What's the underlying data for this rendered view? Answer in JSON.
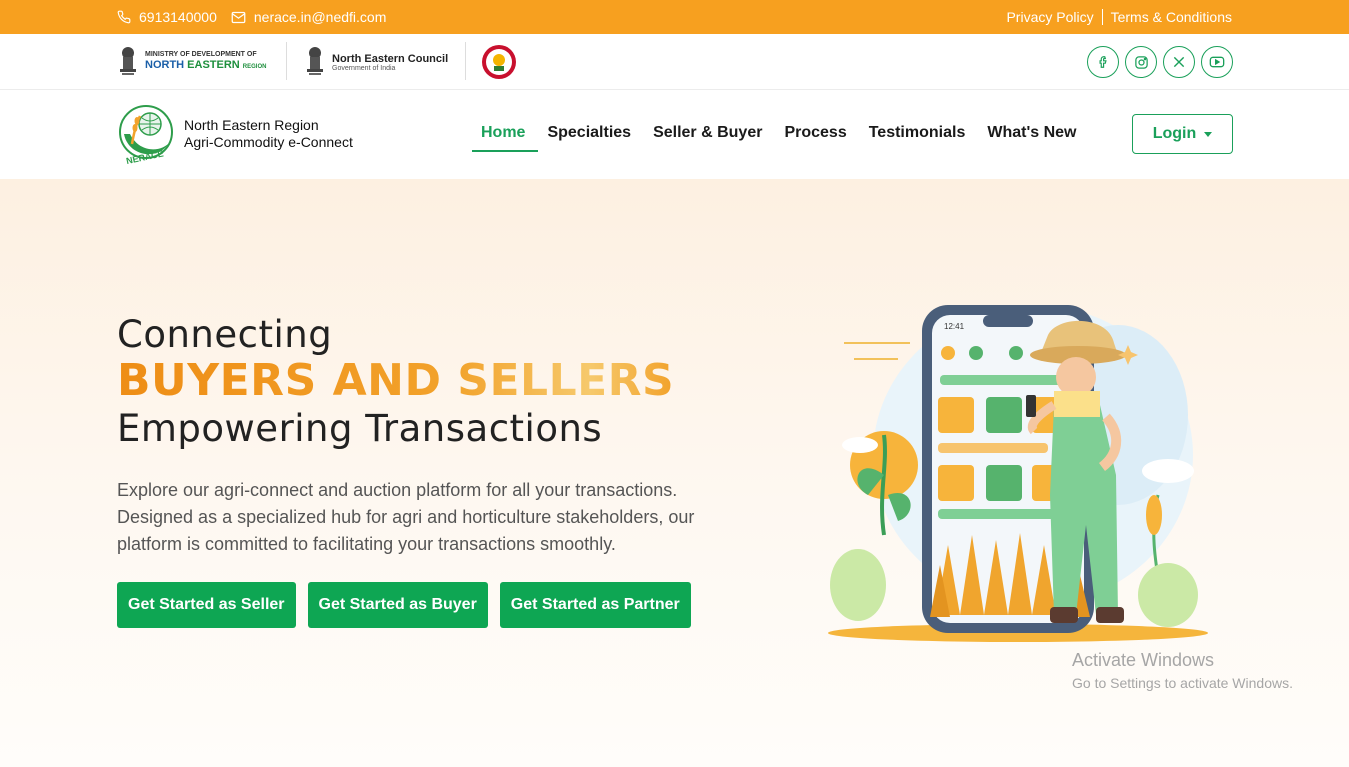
{
  "topbar": {
    "phone": "6913140000",
    "email": "nerace.in@nedfi.com",
    "privacy": "Privacy Policy",
    "terms": "Terms & Conditions"
  },
  "logos": {
    "mdoner_line1": "MINISTRY OF DEVELOPMENT OF",
    "mdoner_line2a": "NORTH ",
    "mdoner_line2b": "EASTERN",
    "mdoner_line3": "REGION",
    "nec_title": "North Eastern Council",
    "nec_sub": "Government of India"
  },
  "brand": {
    "line1": "North Eastern Region",
    "line2": "Agri-Commodity e-Connect",
    "badge": "NERACE"
  },
  "nav": {
    "items": [
      "Home",
      "Specialties",
      "Seller & Buyer",
      "Process",
      "Testimonials",
      "What's New"
    ],
    "login": "Login"
  },
  "hero": {
    "line1": "Connecting",
    "line2": "BUYERS AND SELLERS",
    "line3": "Empowering Transactions",
    "description": "Explore our agri-connect and auction platform for all your transactions. Designed as a specialized hub for agri and horticulture stakeholders, our platform is committed to facilitating your transactions smoothly.",
    "buttons": [
      "Get Started as Seller",
      "Get Started as Buyer",
      "Get Started as Partner"
    ],
    "phone_time": "12:41"
  },
  "watermark": {
    "title": "Activate Windows",
    "subtitle": "Go to Settings to activate Windows."
  },
  "colors": {
    "primary_green": "#0ea653",
    "accent_orange": "#f7a01f"
  },
  "icons": [
    "phone-icon",
    "mail-icon",
    "facebook-icon",
    "instagram-icon",
    "x-icon",
    "youtube-icon"
  ]
}
